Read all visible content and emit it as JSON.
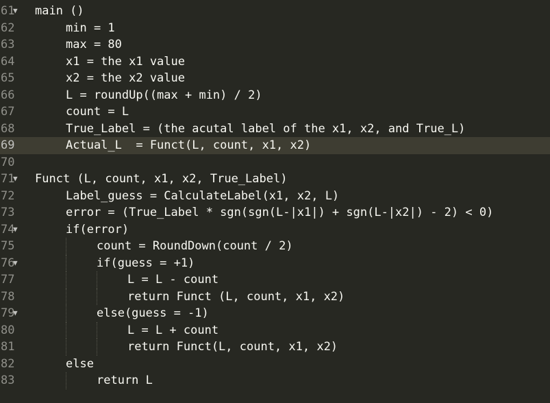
{
  "editor": {
    "lines": [
      {
        "num": "61",
        "fold": true,
        "indent": 0,
        "text": "main ()"
      },
      {
        "num": "62",
        "fold": false,
        "indent": 1,
        "text": "min = 1"
      },
      {
        "num": "63",
        "fold": false,
        "indent": 1,
        "text": "max = 80"
      },
      {
        "num": "64",
        "fold": false,
        "indent": 1,
        "text": "x1 = the x1 value"
      },
      {
        "num": "65",
        "fold": false,
        "indent": 1,
        "text": "x2 = the x2 value"
      },
      {
        "num": "66",
        "fold": false,
        "indent": 1,
        "text": "L = roundUp((max + min) / 2)"
      },
      {
        "num": "67",
        "fold": false,
        "indent": 1,
        "text": "count = L"
      },
      {
        "num": "68",
        "fold": false,
        "indent": 1,
        "text": "True_Label = (the acutal label of the x1, x2, and True_L)"
      },
      {
        "num": "69",
        "fold": false,
        "indent": 1,
        "text": "Actual_L  = Funct(L, count, x1, x2)",
        "active": true
      },
      {
        "num": "70",
        "fold": false,
        "indent": 0,
        "text": ""
      },
      {
        "num": "71",
        "fold": true,
        "indent": 0,
        "text": "Funct (L, count, x1, x2, True_Label)"
      },
      {
        "num": "72",
        "fold": false,
        "indent": 1,
        "text": "Label_guess = CalculateLabel(x1, x2, L)"
      },
      {
        "num": "73",
        "fold": false,
        "indent": 1,
        "text": "error = (True_Label * sgn(sgn(L-|x1|) + sgn(L-|x2|) - 2) < 0)"
      },
      {
        "num": "74",
        "fold": true,
        "indent": 1,
        "text": "if(error)"
      },
      {
        "num": "75",
        "fold": false,
        "indent": 2,
        "text": "count = RoundDown(count / 2)"
      },
      {
        "num": "76",
        "fold": true,
        "indent": 2,
        "text": "if(guess = +1)"
      },
      {
        "num": "77",
        "fold": false,
        "indent": 3,
        "text": "L = L - count"
      },
      {
        "num": "78",
        "fold": false,
        "indent": 3,
        "text": "return Funct (L, count, x1, x2)"
      },
      {
        "num": "79",
        "fold": true,
        "indent": 2,
        "text": "else(guess = -1)"
      },
      {
        "num": "80",
        "fold": false,
        "indent": 3,
        "text": "L = L + count"
      },
      {
        "num": "81",
        "fold": false,
        "indent": 3,
        "text": "return Funct(L, count, x1, x2)"
      },
      {
        "num": "82",
        "fold": false,
        "indent": 1,
        "text": "else"
      },
      {
        "num": "83",
        "fold": false,
        "indent": 2,
        "text": "return L"
      }
    ],
    "fold_glyph": "▼"
  },
  "colors": {
    "background": "#272822",
    "text": "#f8f8f2",
    "gutter_text": "#90908a",
    "active_line": "#3e3d32"
  }
}
